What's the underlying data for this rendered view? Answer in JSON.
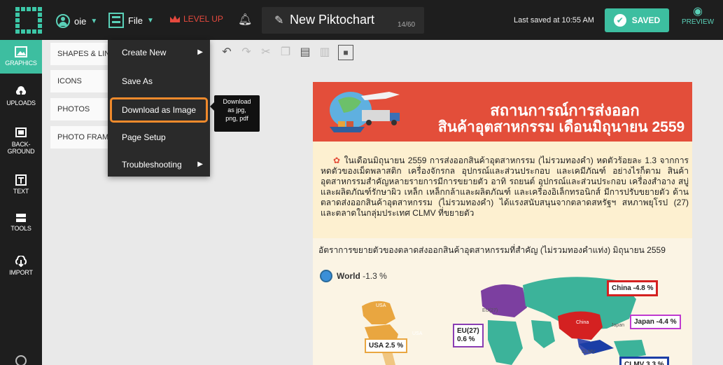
{
  "header": {
    "account_name": "oie",
    "file_label": "File",
    "levelup_label": "LEVEL UP",
    "doc_title": "New Piktochart",
    "title_counter": "14/60",
    "last_saved": "Last saved at 10:55 AM",
    "saved_label": "SAVED",
    "preview_label": "PREVIEW"
  },
  "colors": {
    "accent": "#3dbea0",
    "highlight": "#f08a2c",
    "banner": "#e34e3a",
    "levelup": "#e5493e"
  },
  "leftnav": [
    {
      "label": "GRAPHICS",
      "icon": "image-icon",
      "active": true
    },
    {
      "label": "UPLOADS",
      "icon": "upload-icon",
      "active": false
    },
    {
      "label": "BACK-",
      "label2": "GROUND",
      "icon": "background-icon",
      "active": false
    },
    {
      "label": "TEXT",
      "icon": "text-icon",
      "active": false
    },
    {
      "label": "TOOLS",
      "icon": "tools-icon",
      "active": false
    },
    {
      "label": "IMPORT",
      "icon": "import-icon",
      "active": false
    }
  ],
  "categories": [
    "SHAPES & LINES",
    "ICONS",
    "PHOTOS",
    "PHOTO FRAMES"
  ],
  "menu": {
    "items": [
      {
        "label": "Create New",
        "has_submenu": true
      },
      {
        "label": "Save As",
        "has_submenu": false
      },
      {
        "label": "Download as Image",
        "has_submenu": false
      },
      {
        "label": "Page Setup",
        "has_submenu": false
      },
      {
        "label": "Troubleshooting",
        "has_submenu": true
      }
    ],
    "tooltip": {
      "line1": "Download",
      "line2": "as jpg,",
      "line3": "png, pdf"
    }
  },
  "infographic": {
    "banner_line1": "สถานการณ์การส่งออก",
    "banner_line2": "สินค้าอุตสาหกรรม เดือนมิถุนายน 2559",
    "intro": "ในเดือนมิถุนายน 2559 การส่งออกสินค้าอุตสาหกรรม (ไม่รวมทองคำ) หดตัวร้อยละ 1.3 จากการหดตัวของเม็ดพลาสติก เครื่องจักรกล อุปกรณ์และส่วนประกอบ และเคมีภัณฑ์ อย่างไรก็ตาม สินค้าอุตสาหกรรมสำคัญหลายรายการมีการขยายตัว อาทิ รถยนต์ อุปกรณ์และส่วนประกอบ เครื่องสำอาง สบู่ และผลิตภัณฑ์รักษาผิว เหล็ก เหล็กกล้าและผลิตภัณฑ์ และเครื่องอิเล็กทรอนิกส์ มีการปรับขยายตัว ด้านตลาดส่งออกสินค้าอุตสาหกรรม (ไม่รวมทองคำ) ได้แรงสนับสนุนจากตลาดสหรัฐฯ สหภาพยุโรป (27) และตลาดในกลุ่มประเทศ CLMV ที่ขยายตัว",
    "chart_title": "อัตราการขยายตัวของตลาดส่งออกสินค้าอุตสาหกรรมที่สำคัญ (ไม่รวมทองคำแท่ง) มิถุนายน 2559",
    "world_label": "World",
    "world_value": "-1.3 %",
    "labels": {
      "usa_map": "USA",
      "eu_map": "EU(27)",
      "usa_map2": "USA",
      "japan_map": "Japan",
      "china_map": "China",
      "clmv_map": "CLMV",
      "eu_box_1": "EU(27)",
      "eu_box_2": "0.6 %",
      "usa_box": "USA  2.5 %",
      "china_box": "China -4.8 %",
      "japan_box": "Japan  -4.4 %",
      "clmv_box": "CLMV 3.3 %"
    }
  }
}
